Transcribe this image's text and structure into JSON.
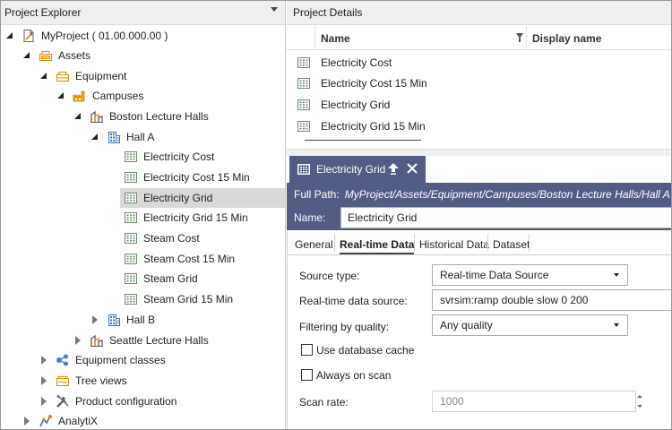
{
  "explorer": {
    "title": "Project Explorer",
    "tree": [
      {
        "label": "MyProject ( 01.00.000.00 )",
        "icon": "project-icon",
        "state": "open"
      },
      {
        "label": "Assets",
        "icon": "assets-icon",
        "state": "open"
      },
      {
        "label": "Equipment",
        "icon": "equipment-icon",
        "state": "open"
      },
      {
        "label": "Campuses",
        "icon": "campus-icon",
        "state": "open"
      },
      {
        "label": "Boston Lecture Halls",
        "icon": "site-icon",
        "state": "open"
      },
      {
        "label": "Hall A",
        "icon": "building-icon",
        "state": "open"
      },
      {
        "label": "Electricity Cost",
        "icon": "tag-icon"
      },
      {
        "label": "Electricity Cost 15 Min",
        "icon": "tag-icon"
      },
      {
        "label": "Electricity Grid",
        "icon": "tag-icon",
        "selected": true
      },
      {
        "label": "Electricity Grid 15 Min",
        "icon": "tag-icon"
      },
      {
        "label": "Steam Cost",
        "icon": "tag-icon"
      },
      {
        "label": "Steam Cost 15 Min",
        "icon": "tag-icon"
      },
      {
        "label": "Steam Grid",
        "icon": "tag-icon"
      },
      {
        "label": "Steam Grid 15 Min",
        "icon": "tag-icon"
      },
      {
        "label": "Hall B",
        "icon": "building-icon",
        "state": "closed"
      },
      {
        "label": "Seattle Lecture Halls",
        "icon": "site-icon",
        "state": "closed"
      },
      {
        "label": "Equipment classes",
        "icon": "equipment-classes-icon",
        "state": "closed"
      },
      {
        "label": "Tree views",
        "icon": "tree-views-icon",
        "state": "closed"
      },
      {
        "label": "Product configuration",
        "icon": "tools-icon",
        "state": "closed"
      },
      {
        "label": "AnalytiX",
        "icon": "analytix-icon",
        "state": "closed"
      }
    ]
  },
  "details": {
    "title": "Project Details",
    "columns": {
      "name": "Name",
      "display": "Display name"
    },
    "rows": [
      "Electricity Cost",
      "Electricity Cost 15 Min",
      "Electricity Grid",
      "Electricity Grid 15 Min"
    ]
  },
  "editor": {
    "tab_title": "Electricity Grid",
    "full_path_label": "Full Path:",
    "full_path": "MyProject/Assets/Equipment/Campuses/Boston Lecture Halls/Hall A",
    "name_label": "Name:",
    "name_value": "Electricity Grid",
    "tabs": [
      "General",
      "Real-time Data",
      "Historical Data",
      "Dataset"
    ],
    "active_tab": "Real-time Data",
    "form": {
      "source_type_label": "Source type:",
      "source_type_value": "Real-time Data Source",
      "rt_source_label": "Real-time data source:",
      "rt_source_value": "svrsim:ramp double slow 0 200",
      "filter_label": "Filtering by quality:",
      "filter_value": "Any quality",
      "db_cache_label": "Use database cache",
      "always_scan_label": "Always on scan",
      "scan_rate_label": "Scan rate:",
      "scan_rate_value": "1000"
    }
  },
  "colors": {
    "accent": "#535c85",
    "selection": "#d9d9d9"
  }
}
